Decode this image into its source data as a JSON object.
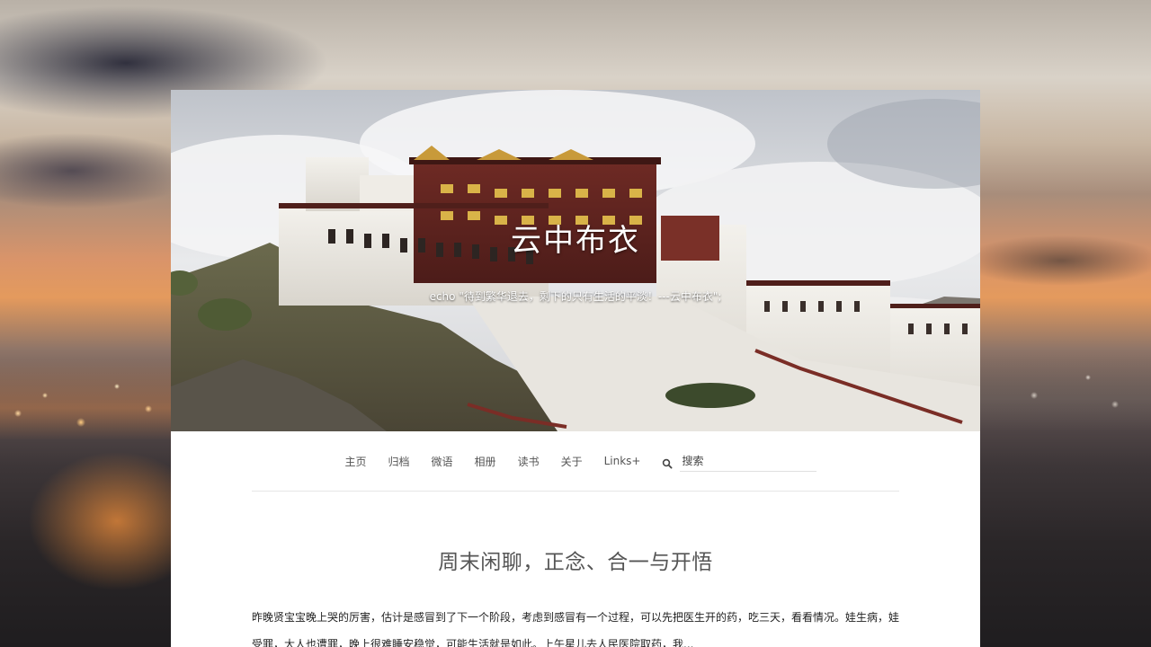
{
  "site": {
    "title": "云中布衣",
    "motto": "echo \"待到繁华退去，剩下的只有生活的平淡！---云中布衣\";"
  },
  "nav": {
    "items": [
      {
        "label": "主页"
      },
      {
        "label": "归档"
      },
      {
        "label": "微语"
      },
      {
        "label": "相册"
      },
      {
        "label": "读书"
      },
      {
        "label": "关于"
      },
      {
        "label": "Links+"
      }
    ],
    "search": {
      "icon": "search-icon",
      "placeholder": "搜索"
    }
  },
  "post": {
    "title": "周末闲聊，正念、合一与开悟",
    "excerpt": "昨晚贤宝宝晚上哭的厉害，估计是感冒到了下一个阶段，考虑到感冒有一个过程，可以先把医生开的药，吃三天，看看情况。娃生病，娃受罪，大人也遭罪，晚上很难睡安稳觉，可能生活就是如此。上午星儿去人民医院取药，我..."
  },
  "colors": {
    "page_bg": "#ffffff",
    "nav_text": "#555555",
    "title_text": "#555555",
    "body_text": "#222222"
  }
}
